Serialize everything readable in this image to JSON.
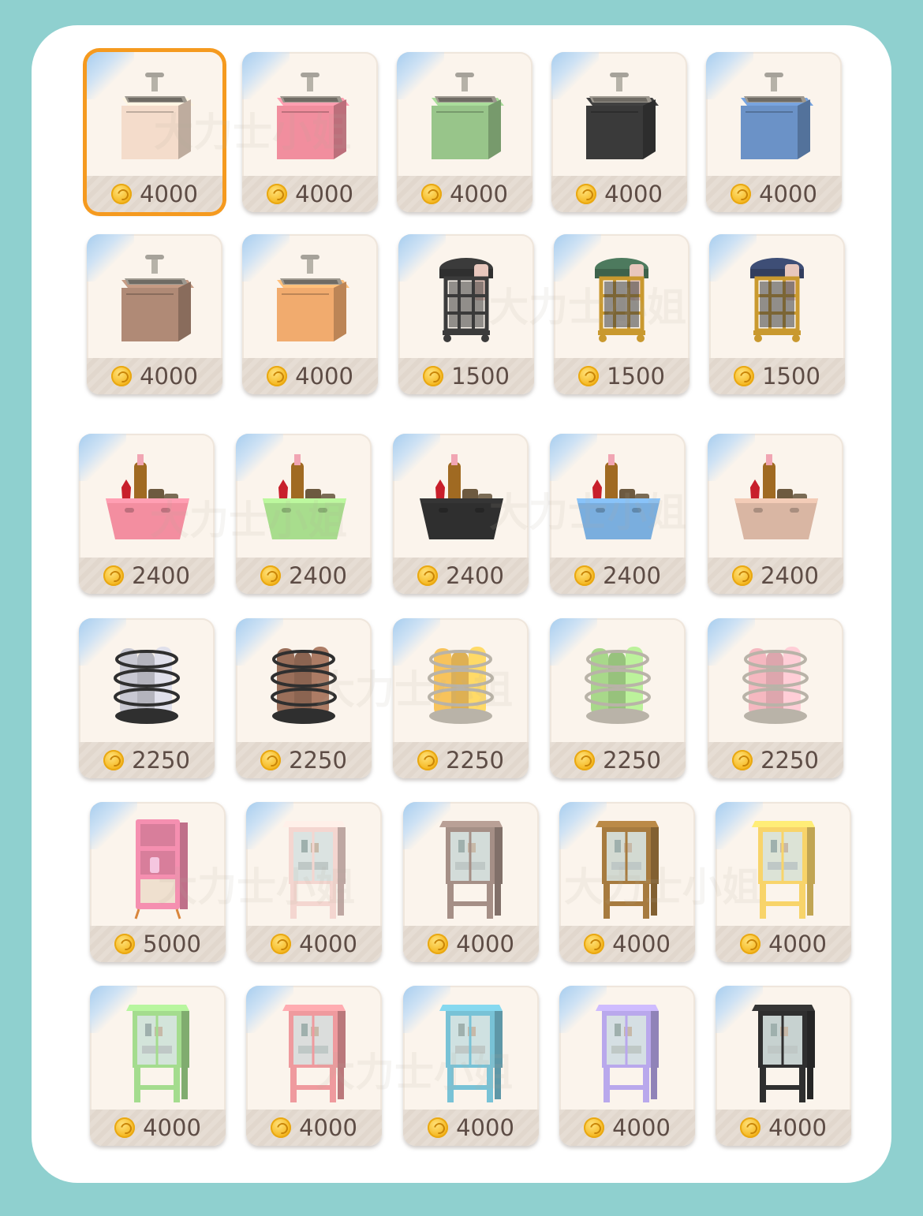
{
  "watermark": "大力士小姐",
  "items": [
    {
      "kind": "sink",
      "color": "#f4dccb",
      "price": "4000",
      "selected": true
    },
    {
      "kind": "sink",
      "color": "#f18e9e",
      "price": "4000"
    },
    {
      "kind": "sink",
      "color": "#98c58a",
      "price": "4000"
    },
    {
      "kind": "sink",
      "color": "#3a3a3a",
      "price": "4000"
    },
    {
      "kind": "sink",
      "color": "#6b92c7",
      "price": "4000"
    },
    {
      "kind": "sink",
      "color": "#b08a76",
      "price": "4000"
    },
    {
      "kind": "sink",
      "color": "#f1ab6e",
      "price": "4000"
    },
    {
      "kind": "hamper",
      "color": "#3b3b3b",
      "frame": "#3b3b3b",
      "price": "1500"
    },
    {
      "kind": "hamper",
      "color": "#4d7a5e",
      "frame": "#c9992f",
      "price": "1500"
    },
    {
      "kind": "hamper",
      "color": "#3e4e76",
      "frame": "#c9992f",
      "price": "1500"
    },
    {
      "kind": "basket",
      "color": "#f38ea0",
      "price": "2400"
    },
    {
      "kind": "basket",
      "color": "#a8dd8d",
      "price": "2400"
    },
    {
      "kind": "basket",
      "color": "#2f2f2f",
      "price": "2400"
    },
    {
      "kind": "basket",
      "color": "#7aaede",
      "price": "2400"
    },
    {
      "kind": "basket",
      "color": "#d9b6a3",
      "price": "2400"
    },
    {
      "kind": "towels",
      "color": "#c8c8d2",
      "frame": "#2f2f2f",
      "price": "2250"
    },
    {
      "kind": "towels",
      "color": "#9a6f5a",
      "frame": "#2f2f2f",
      "price": "2250"
    },
    {
      "kind": "towels",
      "color": "#f7c35c",
      "frame": "#b9b3a8",
      "price": "2250"
    },
    {
      "kind": "towels",
      "color": "#a8d88a",
      "frame": "#b9b3a8",
      "price": "2250"
    },
    {
      "kind": "towels",
      "color": "#f5b8c0",
      "frame": "#b9b3a8",
      "price": "2250"
    },
    {
      "kind": "shelf",
      "color": "#f58fb0",
      "price": "5000"
    },
    {
      "kind": "cabinet",
      "color": "#f4d6d0",
      "price": "4000"
    },
    {
      "kind": "cabinet",
      "color": "#a58f86",
      "price": "4000"
    },
    {
      "kind": "cabinet",
      "color": "#a77b3f",
      "price": "4000"
    },
    {
      "kind": "cabinet",
      "color": "#f8d46a",
      "price": "4000"
    },
    {
      "kind": "cabinet",
      "color": "#a4dc8e",
      "price": "4000"
    },
    {
      "kind": "cabinet",
      "color": "#ef9a9e",
      "price": "4000"
    },
    {
      "kind": "cabinet",
      "color": "#78c2d6",
      "price": "4000"
    },
    {
      "kind": "cabinet",
      "color": "#b9a8ec",
      "price": "4000"
    },
    {
      "kind": "cabinet",
      "color": "#2f2f2f",
      "price": "4000"
    }
  ]
}
